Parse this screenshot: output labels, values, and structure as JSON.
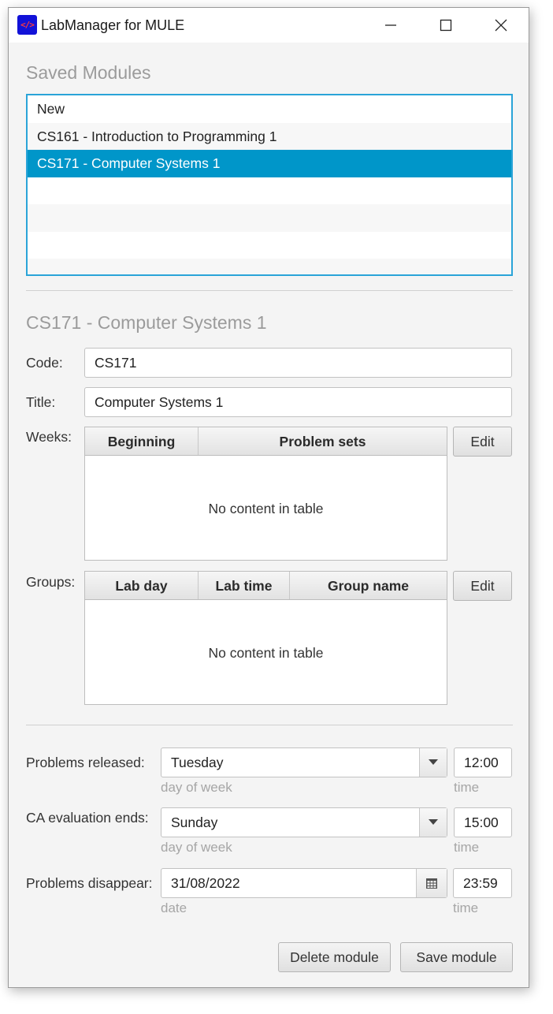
{
  "window": {
    "title": "LabManager for MULE",
    "icon_text": "</>",
    "controls": [
      "minimize-icon",
      "maximize-icon",
      "close-icon"
    ]
  },
  "saved_modules": {
    "heading": "Saved Modules",
    "items": [
      {
        "label": "New",
        "selected": false
      },
      {
        "label": "CS161 - Introduction to Programming 1",
        "selected": false
      },
      {
        "label": "CS171 - Computer Systems 1",
        "selected": true
      }
    ]
  },
  "module": {
    "heading": "CS171 - Computer Systems 1",
    "code_label": "Code:",
    "code_value": "CS171",
    "title_label": "Title:",
    "title_value": "Computer Systems 1",
    "weeks_label": "Weeks:",
    "weeks_columns": [
      "Beginning",
      "Problem sets"
    ],
    "weeks_empty": "No content in table",
    "weeks_edit": "Edit",
    "groups_label": "Groups:",
    "groups_columns": [
      "Lab day",
      "Lab time",
      "Group name"
    ],
    "groups_empty": "No content in table",
    "groups_edit": "Edit"
  },
  "schedule": {
    "released_label": "Problems released:",
    "released_day": "Tuesday",
    "released_time": "12:00",
    "released_day_hint": "day of week",
    "released_time_hint": "time",
    "ca_label": "CA evaluation ends:",
    "ca_day": "Sunday",
    "ca_time": "15:00",
    "ca_day_hint": "day of week",
    "ca_time_hint": "time",
    "disappear_label": "Problems disappear:",
    "disappear_date": "31/08/2022",
    "disappear_time": "23:59",
    "disappear_date_hint": "date",
    "disappear_time_hint": "time"
  },
  "actions": {
    "delete": "Delete module",
    "save": "Save module"
  },
  "colors": {
    "selection": "#0096c9",
    "focus_border": "#2aa4d8",
    "app_icon_bg": "#1212d8"
  }
}
